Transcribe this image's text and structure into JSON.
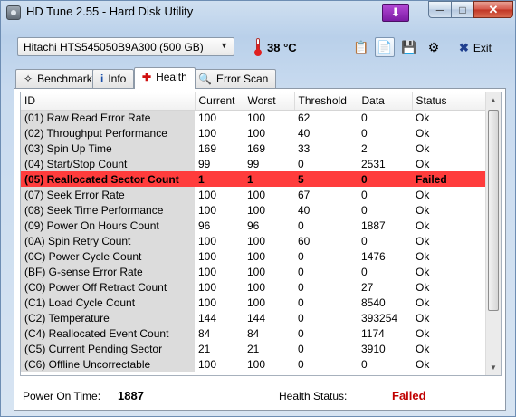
{
  "window": {
    "title": "HD Tune 2.55 - Hard Disk Utility"
  },
  "toolbar": {
    "drive": "Hitachi HTS545050B9A300 (500 GB)",
    "temperature": "38 °C",
    "exit_label": "Exit"
  },
  "tabs": [
    {
      "label": "Benchmark",
      "icon": "speedometer-icon"
    },
    {
      "label": "Info",
      "icon": "info-icon"
    },
    {
      "label": "Health",
      "icon": "red-cross-icon"
    },
    {
      "label": "Error Scan",
      "icon": "magnifier-icon"
    }
  ],
  "table": {
    "columns": [
      "ID",
      "Current",
      "Worst",
      "Threshold",
      "Data",
      "Status"
    ],
    "rows": [
      {
        "id": "(01) Raw Read Error Rate",
        "current": "100",
        "worst": "100",
        "threshold": "62",
        "data": "0",
        "status": "Ok"
      },
      {
        "id": "(02) Throughput Performance",
        "current": "100",
        "worst": "100",
        "threshold": "40",
        "data": "0",
        "status": "Ok"
      },
      {
        "id": "(03) Spin Up Time",
        "current": "169",
        "worst": "169",
        "threshold": "33",
        "data": "2",
        "status": "Ok"
      },
      {
        "id": "(04) Start/Stop Count",
        "current": "99",
        "worst": "99",
        "threshold": "0",
        "data": "2531",
        "status": "Ok"
      },
      {
        "id": "(05) Reallocated Sector Count",
        "current": "1",
        "worst": "1",
        "threshold": "5",
        "data": "0",
        "status": "Failed"
      },
      {
        "id": "(07) Seek Error Rate",
        "current": "100",
        "worst": "100",
        "threshold": "67",
        "data": "0",
        "status": "Ok"
      },
      {
        "id": "(08) Seek Time Performance",
        "current": "100",
        "worst": "100",
        "threshold": "40",
        "data": "0",
        "status": "Ok"
      },
      {
        "id": "(09) Power On Hours Count",
        "current": "96",
        "worst": "96",
        "threshold": "0",
        "data": "1887",
        "status": "Ok"
      },
      {
        "id": "(0A) Spin Retry Count",
        "current": "100",
        "worst": "100",
        "threshold": "60",
        "data": "0",
        "status": "Ok"
      },
      {
        "id": "(0C) Power Cycle Count",
        "current": "100",
        "worst": "100",
        "threshold": "0",
        "data": "1476",
        "status": "Ok"
      },
      {
        "id": "(BF) G-sense Error Rate",
        "current": "100",
        "worst": "100",
        "threshold": "0",
        "data": "0",
        "status": "Ok"
      },
      {
        "id": "(C0) Power Off Retract Count",
        "current": "100",
        "worst": "100",
        "threshold": "0",
        "data": "27",
        "status": "Ok"
      },
      {
        "id": "(C1) Load Cycle Count",
        "current": "100",
        "worst": "100",
        "threshold": "0",
        "data": "8540",
        "status": "Ok"
      },
      {
        "id": "(C2) Temperature",
        "current": "144",
        "worst": "144",
        "threshold": "0",
        "data": "393254",
        "status": "Ok"
      },
      {
        "id": "(C4) Reallocated Event Count",
        "current": "84",
        "worst": "84",
        "threshold": "0",
        "data": "1174",
        "status": "Ok"
      },
      {
        "id": "(C5) Current Pending Sector",
        "current": "21",
        "worst": "21",
        "threshold": "0",
        "data": "3910",
        "status": "Ok"
      },
      {
        "id": "(C6) Offline Uncorrectable",
        "current": "100",
        "worst": "100",
        "threshold": "0",
        "data": "0",
        "status": "Ok"
      }
    ]
  },
  "footer": {
    "power_on_label": "Power On Time:",
    "power_on_value": "1887",
    "health_label": "Health Status:",
    "health_value": "Failed"
  },
  "colors": {
    "failed_row": "#ff3c3c",
    "failed_text": "#c00000",
    "id_column_bg": "#dcdcdc"
  }
}
